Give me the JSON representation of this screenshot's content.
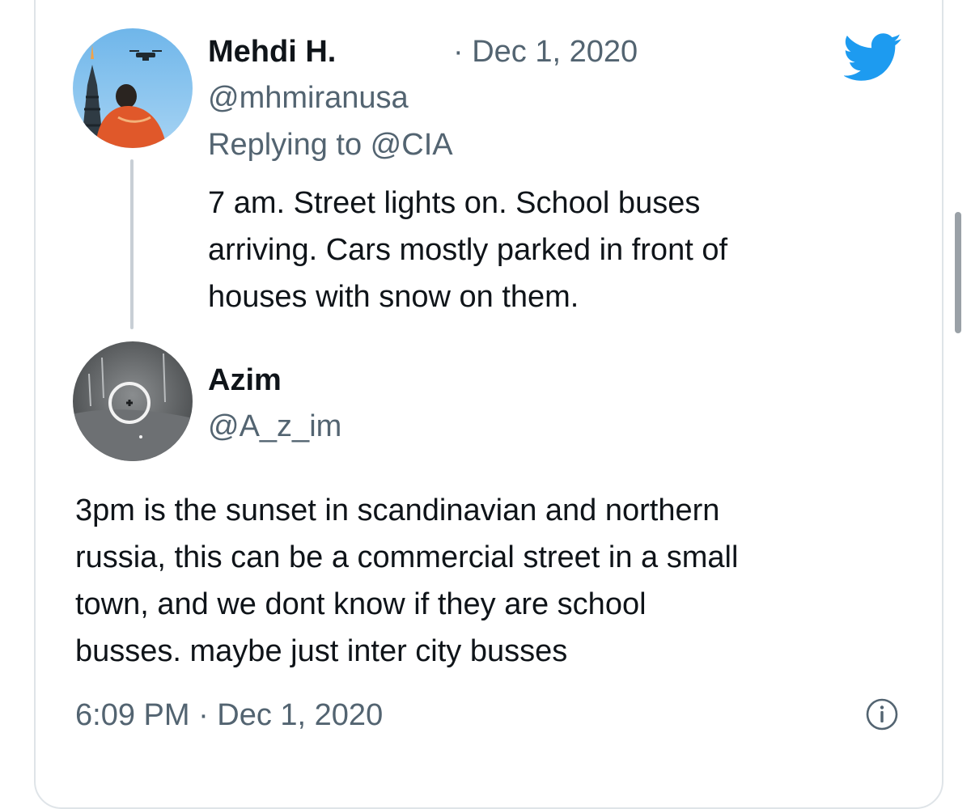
{
  "parent_tweet": {
    "display_name": "Mehdi H.",
    "date": "· Dec 1, 2020",
    "handle": "@mhmiranusa",
    "replying_to_prefix": "Replying to ",
    "replying_to_handle": "@CIA",
    "text": "7 am. Street lights on. School buses\narriving. Cars mostly parked in front of\nhouses with snow on them."
  },
  "reply_tweet": {
    "display_name": "Azim",
    "handle": "@A_z_im",
    "text": "3pm is the sunset in scandinavian and northern\nrussia, this can be a commercial street in a small\ntown, and we dont know if they are school\nbusses. maybe just inter city busses",
    "timestamp": "6:09 PM · Dec 1, 2020"
  },
  "icons": {
    "brand": "twitter-bird-icon",
    "info": "info-icon"
  },
  "colors": {
    "brand_blue": "#1d9bf0",
    "text_primary": "#0f1419",
    "text_secondary": "#536471",
    "border": "#dfe4e8"
  }
}
